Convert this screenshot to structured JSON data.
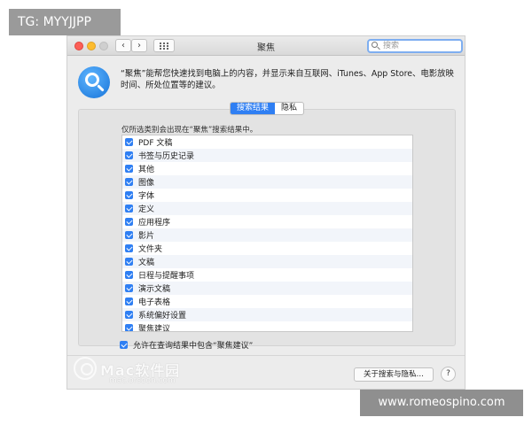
{
  "watermarks": {
    "top_left": "TG: MYYJJPP",
    "bottom_right": "www.romeospino.com",
    "logo_text": "Mac软件园",
    "logo_url": "mac.orsoon.com"
  },
  "window": {
    "title": "聚焦",
    "search_placeholder": "搜索",
    "back_glyph": "‹",
    "forward_glyph": "›"
  },
  "header": {
    "icon": "spotlight-icon",
    "description": "“聚焦”能帮您快速找到电脑上的内容，并显示来自互联网、iTunes、App Store、电影放映时间、所处位置等的建议。"
  },
  "tabs": [
    {
      "label": "搜索结果",
      "active": true
    },
    {
      "label": "隐私",
      "active": false
    }
  ],
  "panel": {
    "label": "仅所选类别会出现在“聚焦”搜索结果中。",
    "categories": [
      {
        "label": "PDF 文稿",
        "checked": true
      },
      {
        "label": "书签与历史记录",
        "checked": true
      },
      {
        "label": "其他",
        "checked": true
      },
      {
        "label": "图像",
        "checked": true
      },
      {
        "label": "字体",
        "checked": true
      },
      {
        "label": "定义",
        "checked": true
      },
      {
        "label": "应用程序",
        "checked": true
      },
      {
        "label": "影片",
        "checked": true
      },
      {
        "label": "文件夹",
        "checked": true
      },
      {
        "label": "文稿",
        "checked": true
      },
      {
        "label": "日程与提醒事项",
        "checked": true
      },
      {
        "label": "演示文稿",
        "checked": true
      },
      {
        "label": "电子表格",
        "checked": true
      },
      {
        "label": "系统偏好设置",
        "checked": true
      },
      {
        "label": "聚焦建议",
        "checked": true
      }
    ],
    "allow_suggestions_label": "允许在查询结果中包含“聚焦建议”",
    "allow_suggestions_checked": true
  },
  "footer": {
    "about_button": "关于搜索与隐私…",
    "help_button": "?"
  },
  "colors": {
    "accent": "#2f7ff3",
    "window_bg": "#ececec"
  }
}
